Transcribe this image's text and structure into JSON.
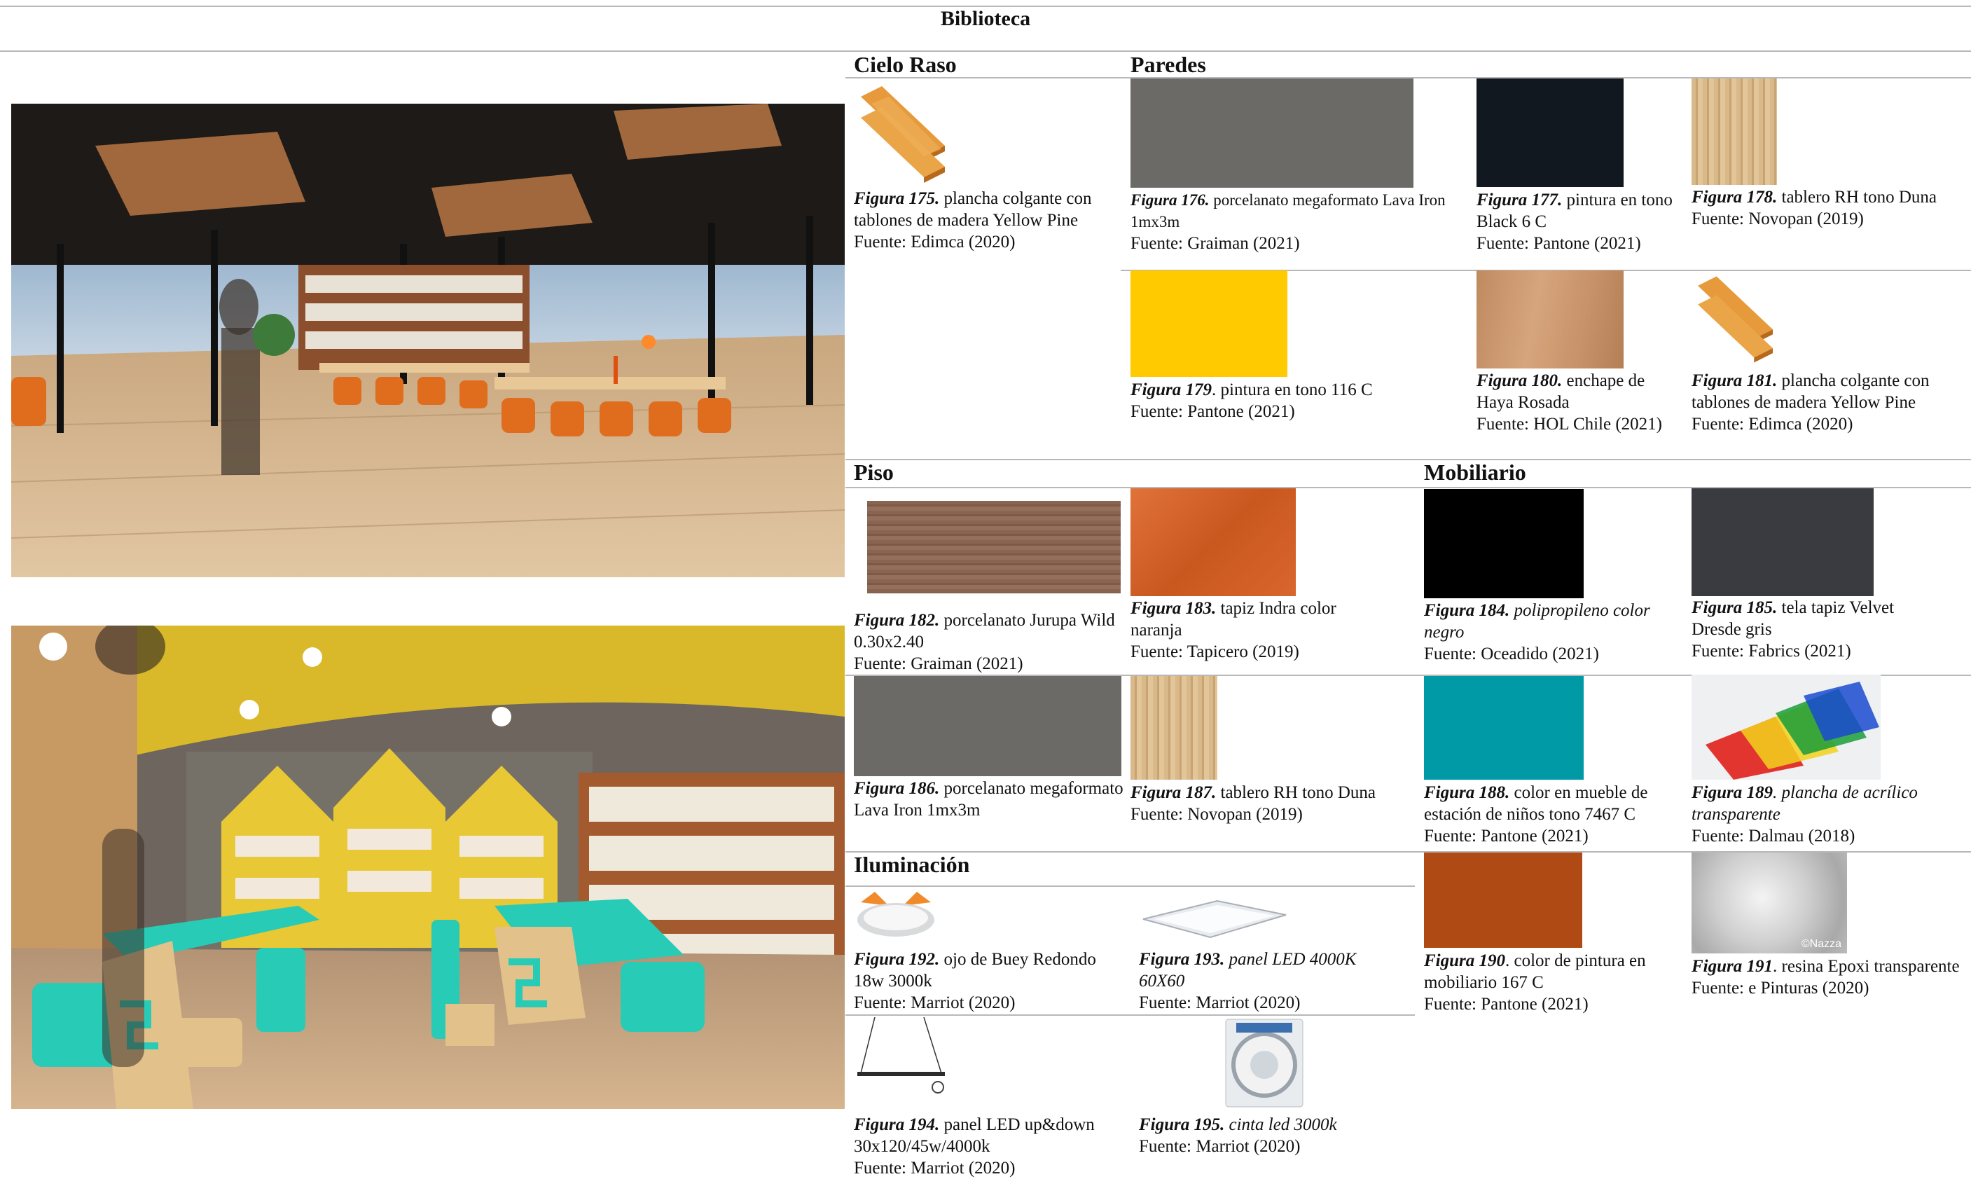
{
  "title": "Biblioteca",
  "sections": {
    "cielo_raso": "Cielo Raso",
    "paredes": "Paredes",
    "piso": "Piso",
    "mobiliario": "Mobiliario",
    "iluminacion": "Iluminación"
  },
  "figures": {
    "f175": {
      "label": "Figura 175.",
      "text": " plancha colgante con tablones de madera Yellow Pine",
      "source": "Fuente: Edimca (2020)"
    },
    "f176": {
      "label": "Figura 176.",
      "text": " porcelanato megaformato Lava Iron 1mx3m",
      "source": "Fuente: Graiman (2021)"
    },
    "f177": {
      "label": "Figura 177.",
      "text": " pintura en tono Black 6 C",
      "source": "Fuente: Pantone (2021)"
    },
    "f178": {
      "label": "Figura 178.",
      "text": " tablero RH tono Duna",
      "source": "Fuente: Novopan (2019)"
    },
    "f179": {
      "label": "Figura 179",
      "text": ". pintura en tono 116 C",
      "source": "Fuente: Pantone (2021)"
    },
    "f180": {
      "label": "Figura 180.",
      "text": " enchape de Haya Rosada",
      "source": "Fuente: HOL Chile (2021)"
    },
    "f181": {
      "label": "Figura 181.",
      "text": " plancha colgante con tablones de madera Yellow Pine",
      "source": "Fuente: Edimca (2020)"
    },
    "f182": {
      "label": "Figura 182.",
      "text": " porcelanato Jurupa Wild 0.30x2.40",
      "source": "Fuente: Graiman (2021)"
    },
    "f183": {
      "label": "Figura 183.",
      "text": " tapiz Indra color naranja",
      "source": "Fuente: Tapicero (2019)"
    },
    "f184": {
      "label": "Figura 184.",
      "text": " polipropileno color negro",
      "source": "Fuente: Oceadido (2021)"
    },
    "f185": {
      "label": "Figura 185.",
      "text": " tela tapiz Velvet Dresde gris",
      "source": "Fuente: Fabrics (2021)"
    },
    "f186": {
      "label": "Figura 186.",
      "text": " porcelanato megaformato Lava Iron 1mx3m",
      "source": ""
    },
    "f187": {
      "label": "Figura 187.",
      "text": " tablero RH tono Duna",
      "source": "Fuente: Novopan (2019)"
    },
    "f188": {
      "label": "Figura 188.",
      "text": " color en mueble de estación de niños tono 7467 C",
      "source": "Fuente: Pantone (2021)"
    },
    "f189": {
      "label": "Figura 189",
      "text": ". plancha de acrílico transparente",
      "source": "Fuente: Dalmau (2018)"
    },
    "f190": {
      "label": "Figura 190",
      "text": ". color de pintura en mobiliario 167 C",
      "source": "Fuente: Pantone (2021)"
    },
    "f191": {
      "label": "Figura 191",
      "text": ". resina Epoxi transparente",
      "source": "Fuente: e Pinturas (2020)"
    },
    "f192": {
      "label": "Figura 192.",
      "text": " ojo de Buey Redondo 18w 3000k",
      "source": "Fuente: Marriot (2020)"
    },
    "f193": {
      "label": "Figura 193.",
      "text": " panel LED 4000K 60X60",
      "source": "Fuente: Marriot (2020)"
    },
    "f194": {
      "label": "Figura 194.",
      "text": " panel LED up&down 30x120/45w/4000k",
      "source": "Fuente: Marriot (2020)"
    },
    "f195": {
      "label": "Figura 195.",
      "text": " cinta led 3000k",
      "source": "Fuente: Marriot (2020)"
    }
  },
  "watermark": "©Nazza",
  "colors": {
    "lava_iron": "#6b6a66",
    "black_6c": "#111820",
    "duna": "#d9b889",
    "yellow_116c": "#ffcb00",
    "haya": "#c8926a",
    "jurupa": "#8a6450",
    "orange_tapiz": "#d9662c",
    "negro": "#000000",
    "velvet": "#3a3b40",
    "teal_7467c": "#009aa6",
    "pintura_167c": "#b04a14"
  }
}
